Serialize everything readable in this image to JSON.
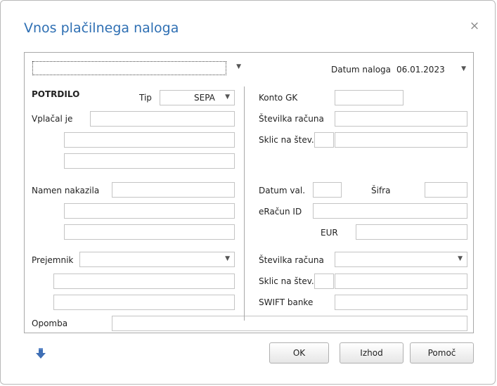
{
  "dialog": {
    "title": "Vnos plačilnega naloga",
    "close_glyph": "×"
  },
  "header": {
    "top_select_value": "",
    "datum_naloga_label": "Datum naloga",
    "datum_naloga_value": "06.01.2023"
  },
  "left": {
    "section_title": "POTRDILO",
    "tip_label": "Tip",
    "tip_value": "SEPA",
    "vplacal_label": "Vplačal je",
    "namen_label": "Namen nakazila",
    "prejemnik_label": "Prejemnik",
    "prejemnik_value": "",
    "opomba_label": "Opomba"
  },
  "right": {
    "konto_label": "Konto GK",
    "stevilka_label": "Številka računa",
    "sklic_label": "Sklic na štev.",
    "datum_val_label": "Datum val.",
    "sifra_label": "Šifra",
    "eracun_label": "eRačun ID",
    "eur_label": "EUR",
    "stevilka2_label": "Številka računa",
    "stevilka2_value": "",
    "sklic2_label": "Sklic na štev.",
    "swift_label": "SWIFT banke"
  },
  "buttons": {
    "ok": "OK",
    "izhod": "Izhod",
    "pomoc": "Pomoč"
  },
  "colors": {
    "title": "#2e6fb3",
    "icon": "#3f6fb5"
  },
  "icons": {
    "close": "close-icon",
    "down": "arrow-down-icon"
  }
}
